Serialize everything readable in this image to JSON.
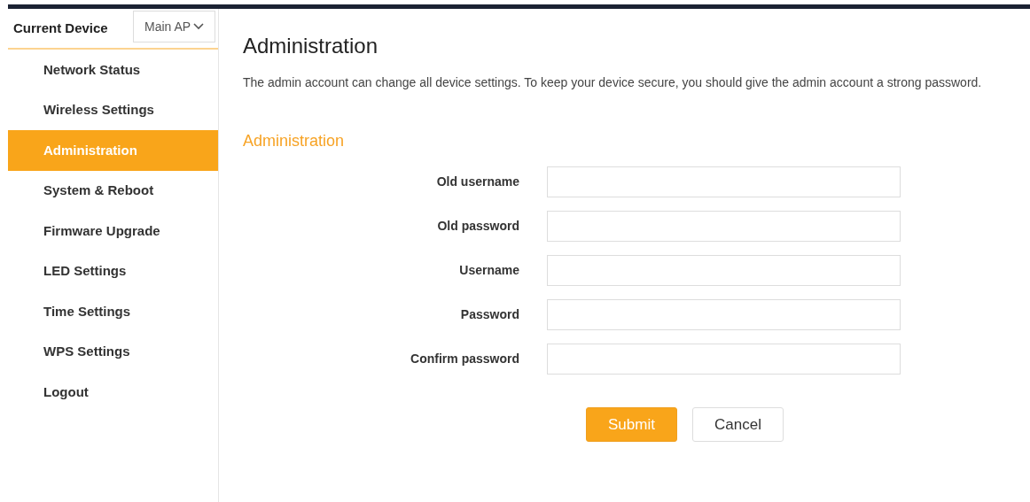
{
  "sidebar": {
    "device_label": "Current Device",
    "device_select": {
      "value": "Main AP"
    },
    "items": [
      {
        "label": "Network Status",
        "selected": false
      },
      {
        "label": "Wireless Settings",
        "selected": false
      },
      {
        "label": "Administration",
        "selected": true
      },
      {
        "label": "System & Reboot",
        "selected": false
      },
      {
        "label": "Firmware Upgrade",
        "selected": false
      },
      {
        "label": "LED Settings",
        "selected": false
      },
      {
        "label": "Time Settings",
        "selected": false
      },
      {
        "label": "WPS Settings",
        "selected": false
      },
      {
        "label": "Logout",
        "selected": false
      }
    ]
  },
  "page": {
    "title": "Administration",
    "description": "The admin account can change all device settings. To keep your device secure, you should give the admin account a strong password.",
    "section_title": "Administration",
    "fields": [
      {
        "label": "Old username"
      },
      {
        "label": "Old password"
      },
      {
        "label": "Username"
      },
      {
        "label": "Password"
      },
      {
        "label": "Confirm password"
      }
    ],
    "buttons": [
      {
        "label": "Submit",
        "kind": "primary"
      },
      {
        "label": "Cancel",
        "kind": "secondary"
      }
    ]
  }
}
